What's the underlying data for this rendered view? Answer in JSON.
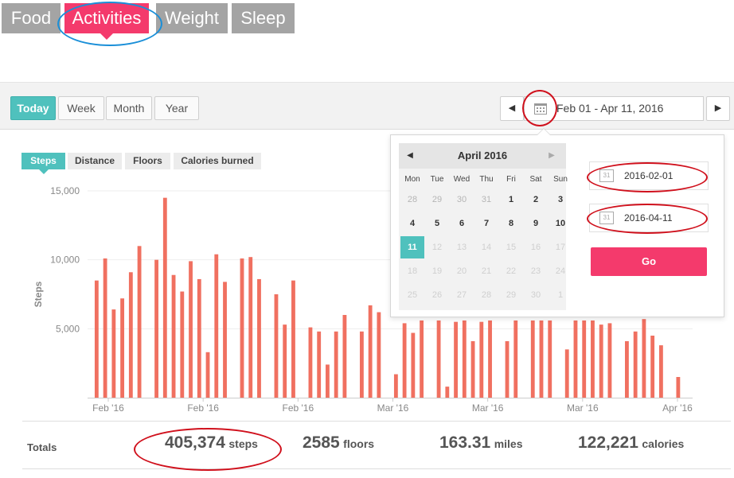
{
  "top_tabs": [
    {
      "label": "Food",
      "active": false
    },
    {
      "label": "Activities",
      "active": true
    },
    {
      "label": "Weight",
      "active": false
    },
    {
      "label": "Sleep",
      "active": false
    }
  ],
  "range_buttons": [
    "Today",
    "Week",
    "Month",
    "Year"
  ],
  "date_range": {
    "text": "Feb 01 - Apr 11, 2016",
    "prev_icon": "triangle-left",
    "next_icon": "triangle-right",
    "calendar_icon": "calendar-icon"
  },
  "metric_tabs": [
    "Steps",
    "Distance",
    "Floors",
    "Calories burned"
  ],
  "chart_data": {
    "type": "bar",
    "ylabel": "Steps",
    "ylim": [
      0,
      15000
    ],
    "yticks": [
      "5,000",
      "10,000",
      "15,000"
    ],
    "ytick_values": [
      5000,
      10000,
      15000
    ],
    "xtick_labels": [
      "Feb '16",
      "Feb '16",
      "Feb '16",
      "Mar '16",
      "Mar '16",
      "Mar '16",
      "Apr '16"
    ],
    "x_start": "2016-02-01",
    "x_end": "2016-04-11",
    "color": "#f07060",
    "values": [
      8500,
      10100,
      6400,
      7200,
      9100,
      11000,
      0,
      10000,
      14500,
      8900,
      7700,
      9900,
      8600,
      3300,
      10400,
      8400,
      0,
      10100,
      10200,
      8600,
      0,
      7500,
      5300,
      8500,
      0,
      5100,
      4800,
      2400,
      4800,
      6000,
      0,
      4800,
      6700,
      6200,
      0,
      1700,
      5400,
      4700,
      5600,
      0,
      5600,
      800,
      5500,
      5600,
      4100,
      5500,
      5600,
      0,
      4100,
      5600,
      0,
      5600,
      5600,
      5600,
      0,
      3500,
      5600,
      5600,
      5600,
      5300,
      5400,
      0,
      4100,
      4800,
      5700,
      4500,
      3800,
      0,
      1500,
      0
    ]
  },
  "totals": {
    "label": "Totals",
    "steps": {
      "value": "405,374",
      "unit": "steps"
    },
    "floors": {
      "value": "2585",
      "unit": "floors"
    },
    "miles": {
      "value": "163.31",
      "unit": "miles"
    },
    "calories": {
      "value": "122,221",
      "unit": "calories"
    }
  },
  "date_picker": {
    "month_title": "April 2016",
    "weekdays": [
      "Mon",
      "Tue",
      "Wed",
      "Thu",
      "Fri",
      "Sat",
      "Sun"
    ],
    "weeks": [
      [
        {
          "d": "28",
          "s": "prevm"
        },
        {
          "d": "29",
          "s": "prevm"
        },
        {
          "d": "30",
          "s": "prevm"
        },
        {
          "d": "31",
          "s": "prevm"
        },
        {
          "d": "1",
          "s": "cur"
        },
        {
          "d": "2",
          "s": "cur"
        },
        {
          "d": "3",
          "s": "cur"
        }
      ],
      [
        {
          "d": "4",
          "s": "cur"
        },
        {
          "d": "5",
          "s": "cur"
        },
        {
          "d": "6",
          "s": "cur"
        },
        {
          "d": "7",
          "s": "cur"
        },
        {
          "d": "8",
          "s": "cur"
        },
        {
          "d": "9",
          "s": "cur"
        },
        {
          "d": "10",
          "s": "cur"
        }
      ],
      [
        {
          "d": "11",
          "s": "sel"
        },
        {
          "d": "12",
          "s": "dis"
        },
        {
          "d": "13",
          "s": "dis"
        },
        {
          "d": "14",
          "s": "dis"
        },
        {
          "d": "15",
          "s": "dis"
        },
        {
          "d": "16",
          "s": "dis"
        },
        {
          "d": "17",
          "s": "dis"
        }
      ],
      [
        {
          "d": "18",
          "s": "dis"
        },
        {
          "d": "19",
          "s": "dis"
        },
        {
          "d": "20",
          "s": "dis"
        },
        {
          "d": "21",
          "s": "dis"
        },
        {
          "d": "22",
          "s": "dis"
        },
        {
          "d": "23",
          "s": "dis"
        },
        {
          "d": "24",
          "s": "dis"
        }
      ],
      [
        {
          "d": "25",
          "s": "dis"
        },
        {
          "d": "26",
          "s": "dis"
        },
        {
          "d": "27",
          "s": "dis"
        },
        {
          "d": "28",
          "s": "dis"
        },
        {
          "d": "29",
          "s": "dis"
        },
        {
          "d": "30",
          "s": "dis"
        },
        {
          "d": "1",
          "s": "dis"
        }
      ]
    ],
    "start_date": "2016-02-01",
    "end_date": "2016-04-11",
    "input_icon_text": "31",
    "go_label": "Go"
  },
  "colors": {
    "accent_pink": "#f43a6c",
    "accent_teal": "#4fc1bd",
    "annotation_blue": "#1a8fd8",
    "annotation_red": "#d0101c",
    "bar": "#f07060"
  }
}
